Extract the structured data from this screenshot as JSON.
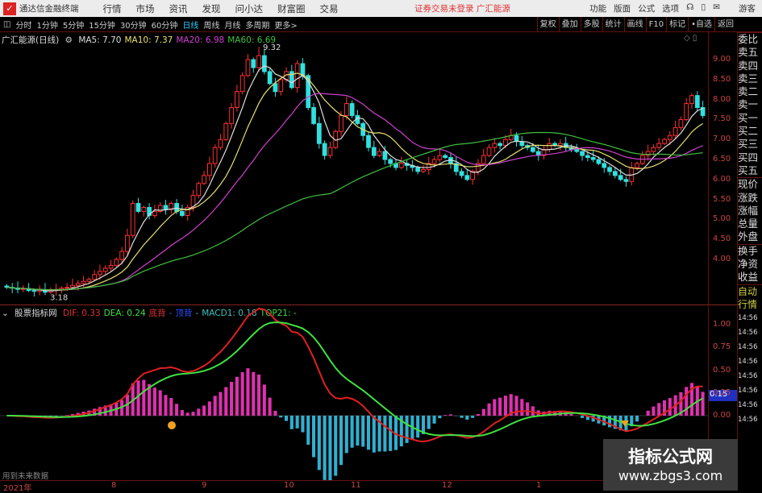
{
  "titlebar": {
    "app": "通达信金融终端",
    "menus": [
      "行情",
      "市场",
      "资讯",
      "发现",
      "问小达",
      "财富圈",
      "交易"
    ],
    "warning": "证券交易未登录 广汇能源",
    "right": [
      "功能",
      "版面",
      "公式",
      "选项"
    ],
    "user": "游客"
  },
  "toolbar": {
    "periods": [
      "分时",
      "1分钟",
      "5分钟",
      "15分钟",
      "30分钟",
      "60分钟",
      "日线",
      "周线",
      "月线",
      "多周期",
      "更多>"
    ],
    "active": "日线",
    "buttons": [
      "复权",
      "叠加",
      "多股",
      "统计",
      "画线",
      "F10",
      "标记",
      "•自选",
      "返回"
    ]
  },
  "main": {
    "stock": "广汇能源(日线)",
    "ma": [
      {
        "label": "MA5: 7.70",
        "color": "#dddddd"
      },
      {
        "label": "MA10: 7.37",
        "color": "#e8e070"
      },
      {
        "label": "MA20: 6.98",
        "color": "#d040d0"
      },
      {
        "label": "MA60: 6.69",
        "color": "#40c040"
      }
    ],
    "high_label": "9.32",
    "low_label": "3.18",
    "price_ticks": [
      "9.00",
      "8.50",
      "8.00",
      "7.50",
      "7.00",
      "6.50",
      "6.00",
      "5.50",
      "5.00",
      "4.50",
      "4.00"
    ],
    "closes": [
      3.3,
      3.28,
      3.25,
      3.27,
      3.22,
      3.2,
      3.24,
      3.18,
      3.22,
      3.25,
      3.28,
      3.3,
      3.35,
      3.4,
      3.45,
      3.5,
      3.62,
      3.7,
      3.78,
      3.85,
      4.0,
      4.2,
      4.6,
      5.4,
      5.2,
      5.3,
      5.1,
      5.2,
      5.35,
      5.25,
      5.4,
      5.2,
      5.1,
      5.3,
      5.6,
      5.9,
      6.1,
      6.4,
      6.8,
      7.0,
      7.4,
      7.8,
      8.2,
      8.6,
      9.0,
      8.8,
      9.1,
      8.7,
      8.4,
      8.2,
      8.5,
      8.7,
      8.3,
      8.9,
      8.6,
      7.8,
      7.4,
      6.9,
      6.6,
      6.8,
      7.2,
      7.6,
      7.9,
      7.6,
      7.4,
      7.1,
      6.8,
      6.6,
      6.7,
      6.5,
      6.4,
      6.3,
      6.4,
      6.35,
      6.3,
      6.2,
      6.25,
      6.4,
      6.5,
      6.6,
      6.55,
      6.4,
      6.2,
      6.1,
      6.0,
      6.2,
      6.4,
      6.6,
      6.8,
      6.9,
      6.85,
      7.0,
      7.1,
      6.95,
      6.85,
      6.8,
      6.7,
      6.6,
      6.75,
      6.9,
      6.85,
      6.9,
      6.8,
      6.75,
      6.7,
      6.6,
      6.55,
      6.5,
      6.4,
      6.3,
      6.2,
      6.1,
      6.0,
      5.95,
      6.3,
      6.4,
      6.6,
      6.7,
      6.8,
      6.9,
      7.0,
      7.1,
      7.3,
      7.5,
      7.9,
      8.1,
      7.8,
      7.6
    ]
  },
  "indicator": {
    "name": "股票指标网",
    "items": [
      {
        "label": "DIF: 0.33",
        "color": "#e03030"
      },
      {
        "label": "DEA: 0.24",
        "color": "#40e040"
      },
      {
        "label": "底背",
        "color": "#e03030"
      },
      {
        "label": "-",
        "color": "#3060ff"
      },
      {
        "label": "顶背",
        "color": "#3050ff"
      },
      {
        "label": "-",
        "color": "#40c0c0"
      },
      {
        "label": "MACD1: 0.18",
        "color": "#40c0c0"
      },
      {
        "label": "TOP21: -",
        "color": "#40e040"
      }
    ],
    "ticks": [
      "1.00",
      "0.75",
      "0.50",
      "0.25",
      "0.00"
    ],
    "current": "0.15",
    "note": "用到未来数据"
  },
  "dates": [
    "2021年",
    "8",
    "9",
    "10",
    "11",
    "12",
    "1"
  ],
  "rightpanel": {
    "quote": [
      "委比",
      "卖五",
      "卖四",
      "卖三",
      "卖二",
      "卖一",
      "买一",
      "买二",
      "买三",
      "买四",
      "买五",
      "现价",
      "涨跌",
      "涨幅",
      "总量",
      "外盘",
      "换手",
      "净资",
      "收益"
    ],
    "ticks": [
      "自动",
      "行情",
      "14:56",
      "14:56",
      "14:56",
      "14:56",
      "14:56",
      "14:56",
      "14:56",
      "14:56"
    ]
  },
  "watermark": {
    "title": "指标公式网",
    "url": "www.zbgs3.com"
  }
}
